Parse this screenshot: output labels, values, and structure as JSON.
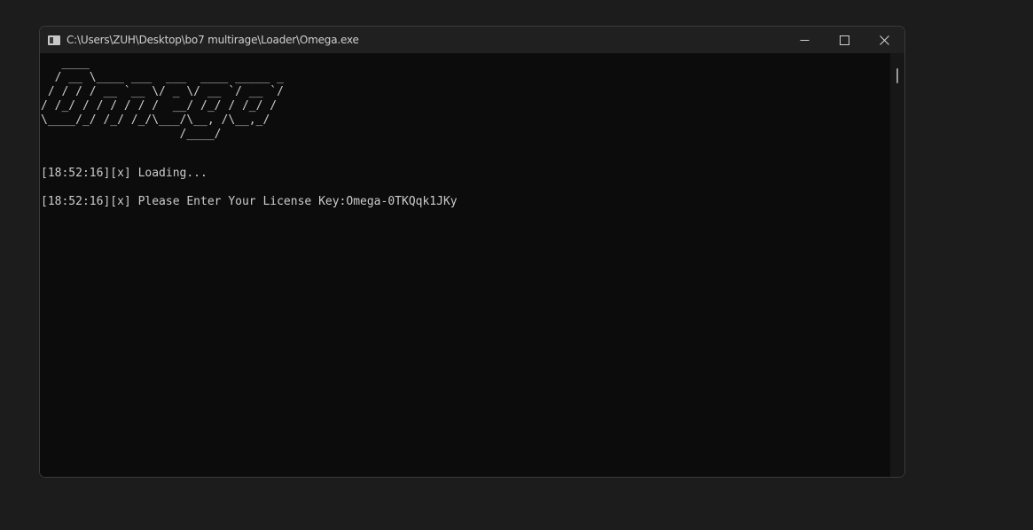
{
  "window": {
    "title": "C:\\Users\\ZUH\\Desktop\\bo7 multirage\\Loader\\Omega.exe"
  },
  "console": {
    "ascii_art": "   ____\n  / __ \\____ ___  ___  ____ _____ _\n / / / / __ `__ \\/ _ \\/ __ `/ __ `/\n/ /_/ / / / / / /  __/ /_/ / /_/ /\n\\____/_/ /_/ /_/\\___/\\__, /\\__,_/\n                    /____/",
    "lines": [
      "[18:52:16][x] Loading...",
      "[18:52:16][x] Please Enter Your License Key:Omega-0TKQqk1JKy"
    ]
  }
}
